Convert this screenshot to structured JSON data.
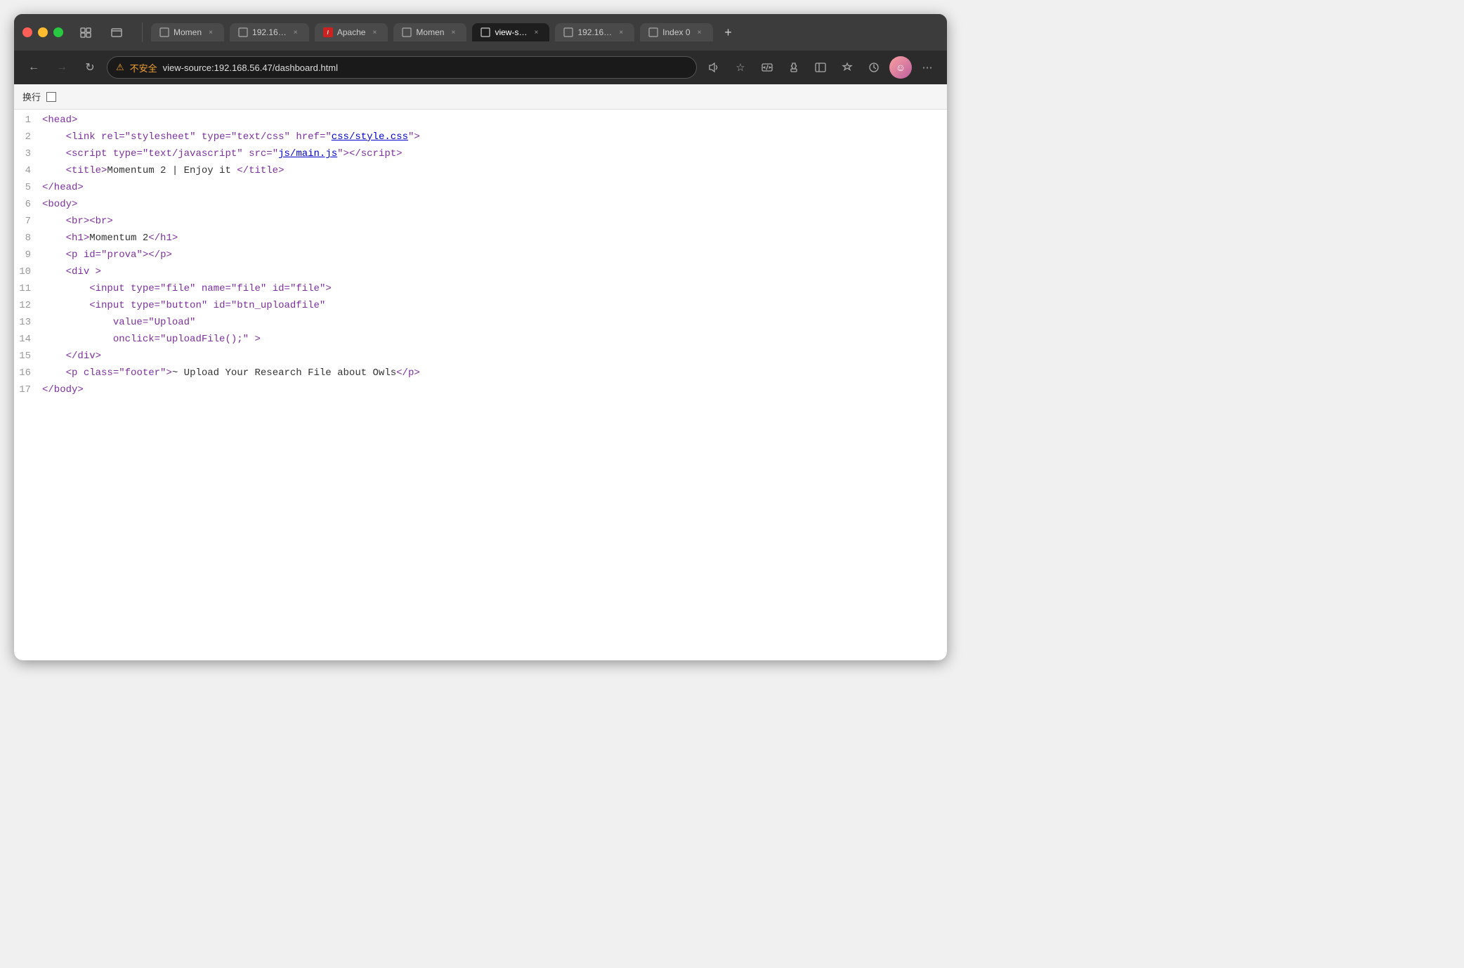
{
  "browser": {
    "traffic_lights": [
      "close",
      "minimize",
      "maximize"
    ],
    "tabs": [
      {
        "id": "tab1",
        "label": "Momen",
        "active": false,
        "icon": "page"
      },
      {
        "id": "tab2",
        "label": "192.16…",
        "active": false,
        "icon": "page"
      },
      {
        "id": "tab3",
        "label": "Apache",
        "active": false,
        "icon": "apache-red"
      },
      {
        "id": "tab4",
        "label": "Momen",
        "active": false,
        "icon": "page"
      },
      {
        "id": "tab5",
        "label": "view-s…",
        "active": true,
        "icon": "page"
      },
      {
        "id": "tab6",
        "label": "192.16…",
        "active": false,
        "icon": "page"
      },
      {
        "id": "tab7",
        "label": "Index 0",
        "active": false,
        "icon": "page"
      }
    ],
    "nav": {
      "back_disabled": false,
      "forward_disabled": true
    },
    "address": {
      "security_label": "不安全",
      "url": "view-source:192.168.56.47/dashboard.html"
    },
    "toolbar": {
      "wrap_label": "换行"
    }
  },
  "source": {
    "lines": [
      {
        "num": 1,
        "content": "<head>"
      },
      {
        "num": 2,
        "content": "    <link rel=\"stylesheet\" type=\"text/css\" href=\"css/style.css\">"
      },
      {
        "num": 3,
        "content": "    <script type=\"text/javascript\" src=\"js/main.js\"><\\/script>"
      },
      {
        "num": 4,
        "content": "    <title>Momentum 2 | Enjoy it <\\/title>"
      },
      {
        "num": 5,
        "content": "<\\/head>"
      },
      {
        "num": 6,
        "content": "<body>"
      },
      {
        "num": 7,
        "content": "    <br><br>"
      },
      {
        "num": 8,
        "content": "    <h1>Momentum 2<\\/h1>"
      },
      {
        "num": 9,
        "content": "    <p id=\"prova\"><\\/p>"
      },
      {
        "num": 10,
        "content": "    <div >"
      },
      {
        "num": 11,
        "content": "        <input type=\"file\" name=\"file\" id=\"file\">"
      },
      {
        "num": 12,
        "content": "        <input type=\"button\" id=\"btn_uploadfile\""
      },
      {
        "num": 13,
        "content": "            value=\"Upload\""
      },
      {
        "num": 14,
        "content": "            onclick=\"uploadFile();\" >"
      },
      {
        "num": 15,
        "content": "    <\\/div>"
      },
      {
        "num": 16,
        "content": "    <p class=\"footer\">~ Upload Your Research File about Owls<\\/p>"
      },
      {
        "num": 17,
        "content": "<\\/body>"
      }
    ]
  }
}
